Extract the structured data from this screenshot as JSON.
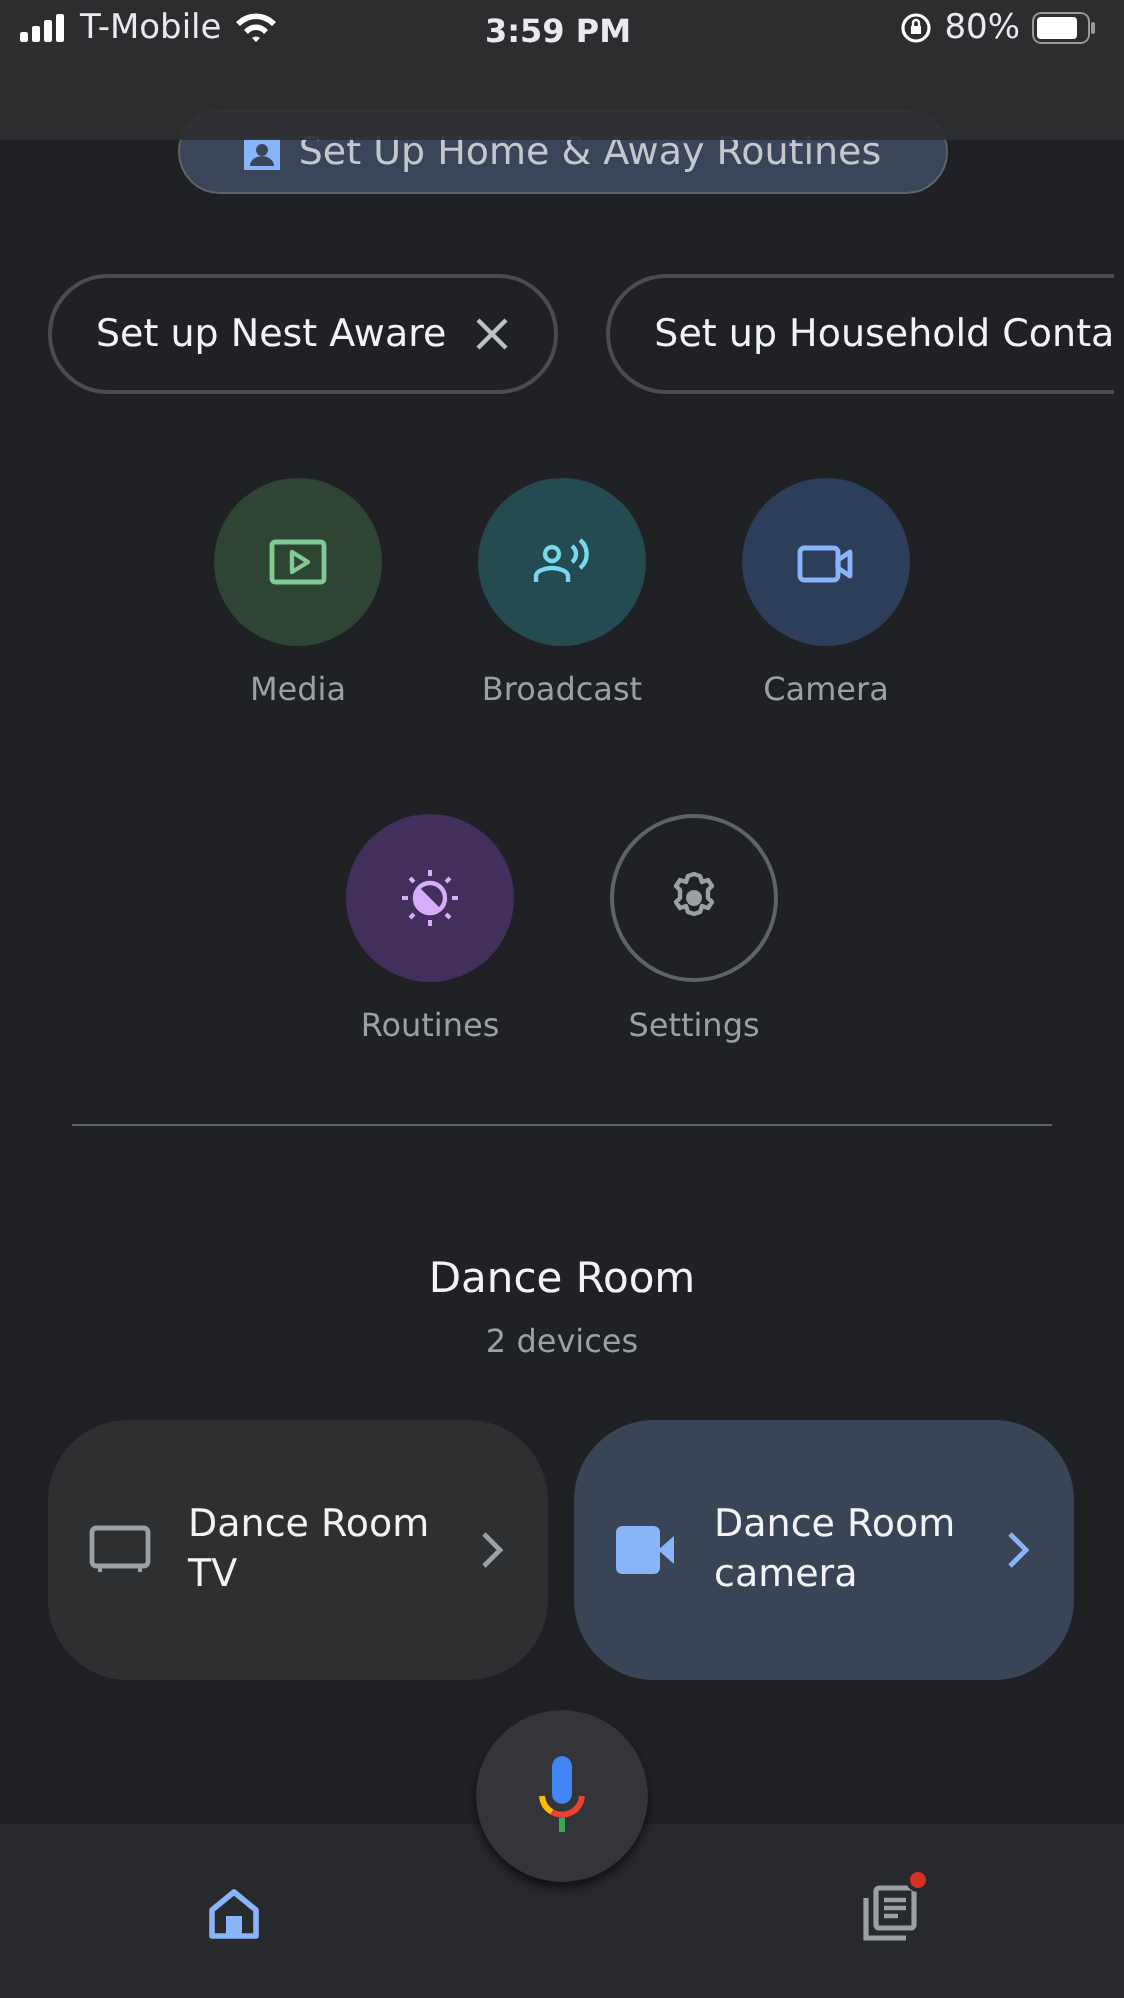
{
  "status_bar": {
    "carrier": "T-Mobile",
    "time": "3:59 PM",
    "battery": "80%"
  },
  "routines_banner": {
    "label": "Set Up Home & Away Routines"
  },
  "chips": [
    {
      "label": "Set up Nest Aware",
      "dismissible": true
    },
    {
      "label": "Set up Household Conta",
      "dismissible": false
    }
  ],
  "actions": [
    {
      "label": "Media",
      "kind": "media"
    },
    {
      "label": "Broadcast",
      "kind": "broadcast"
    },
    {
      "label": "Camera",
      "kind": "camera"
    },
    {
      "label": "Routines",
      "kind": "routines"
    },
    {
      "label": "Settings",
      "kind": "settings"
    }
  ],
  "room": {
    "name": "Dance Room",
    "device_count": "2 devices"
  },
  "devices": [
    {
      "name": "Dance Room TV",
      "kind": "tv",
      "on": false
    },
    {
      "name": "Dance Room camera",
      "kind": "camera",
      "on": true
    }
  ],
  "nav": [
    {
      "kind": "home",
      "selected": true,
      "badge": false
    },
    {
      "kind": "feed",
      "selected": false,
      "badge": true
    }
  ]
}
